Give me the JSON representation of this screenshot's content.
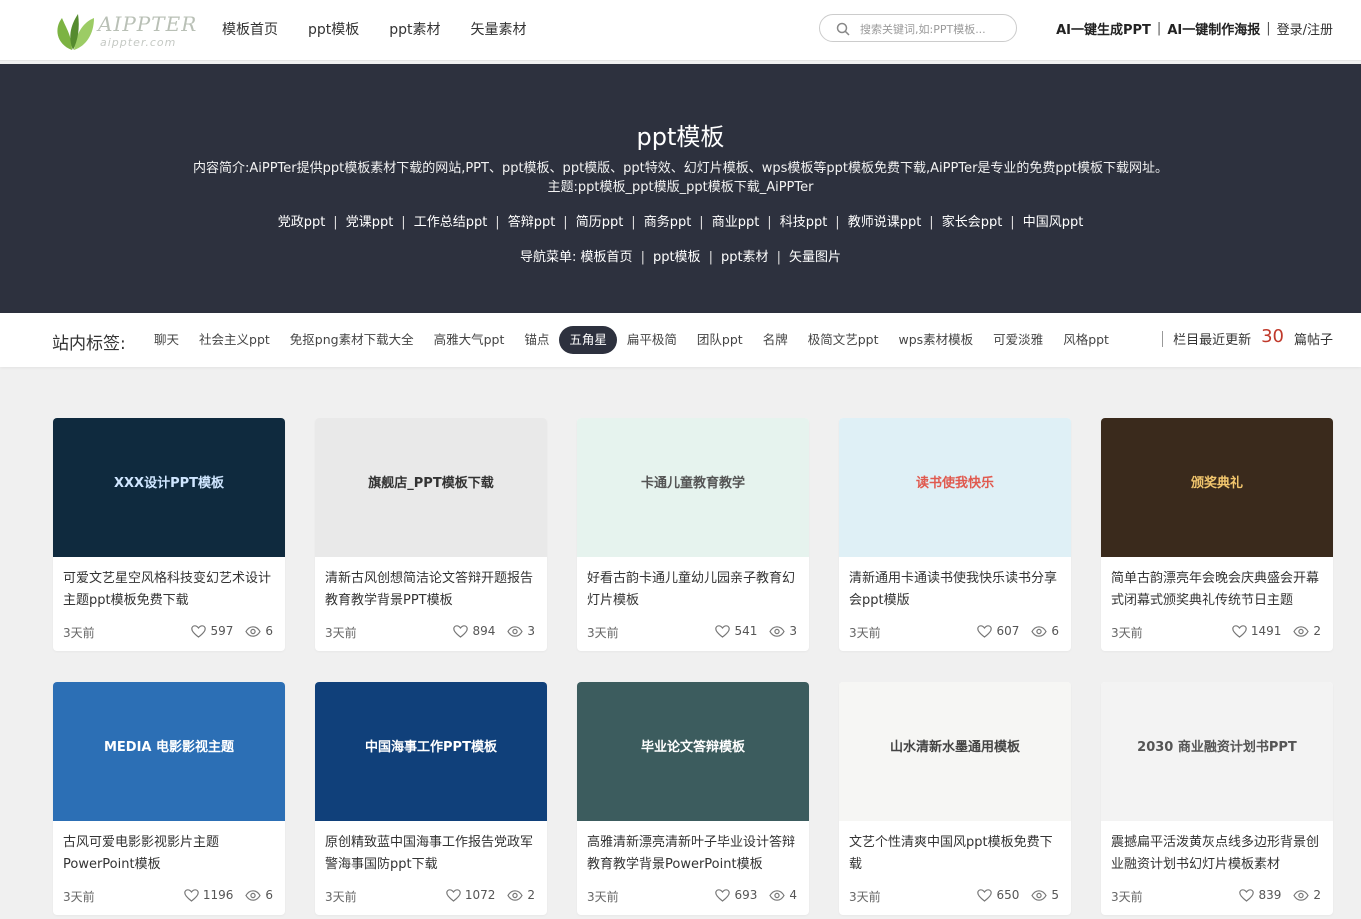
{
  "header": {
    "logo_name": "AIPPTER",
    "logo_sub": "aippter.com",
    "nav": [
      "模板首页",
      "ppt模板",
      "ppt素材",
      "矢量素材"
    ],
    "search_placeholder": "搜索关键词,如:PPT模板...",
    "ai_ppt": "AI一键生成PPT",
    "ai_poster": "AI一键制作海报",
    "login": "登录/注册",
    "sep": "|"
  },
  "hero": {
    "title": "ppt模板",
    "description": "内容简介:AiPPTer提供ppt模板素材下载的网站,PPT、ppt模板、ppt模版、ppt特效、幻灯片模板、wps模板等ppt模板免费下载,AiPPTer是专业的免费ppt模板下载网址。",
    "theme": "主题:ppt模板_ppt模版_ppt模板下载_AiPPTer",
    "tags": [
      "党政ppt",
      "党课ppt",
      "工作总结ppt",
      "答辩ppt",
      "简历ppt",
      "商务ppt",
      "商业ppt",
      "科技ppt",
      "教师说课ppt",
      "家长会ppt",
      "中国风ppt"
    ],
    "menu_label": "导航菜单:",
    "menu": [
      "模板首页",
      "ppt模板",
      "ppt素材",
      "矢量图片"
    ]
  },
  "tagbar": {
    "label": "站内标签:",
    "tags": [
      "聊天",
      "社会主义ppt",
      "免抠png素材下载大全",
      "高雅大气ppt",
      "锚点",
      "五角星",
      "扁平极简",
      "团队ppt",
      "名牌",
      "极简文艺ppt",
      "wps素材模板",
      "可爱淡雅",
      "风格ppt"
    ],
    "active_index": 5,
    "recent_prefix": "栏目最近更新",
    "recent_count": "30",
    "recent_suffix": "篇帖子"
  },
  "cards": [
    {
      "title": "可爱文艺星空风格科技变幻艺术设计主题ppt模板免费下载",
      "time": "3天前",
      "likes": "597",
      "views": "6",
      "thumb_text": "XXX设计PPT模板",
      "thumb_bg": "#0f2a3e",
      "thumb_fg": "#cfe6ff"
    },
    {
      "title": "清新古风创想简洁论文答辩开题报告教育教学背景PPT模板",
      "time": "3天前",
      "likes": "894",
      "views": "3",
      "thumb_text": "旗舰店_PPT模板下载",
      "thumb_bg": "#e9e9e9",
      "thumb_fg": "#333333"
    },
    {
      "title": "好看古韵卡通儿童幼儿园亲子教育幻灯片模板",
      "time": "3天前",
      "likes": "541",
      "views": "3",
      "thumb_text": "卡通儿童教育教学",
      "thumb_bg": "#e6f3ee",
      "thumb_fg": "#555555"
    },
    {
      "title": "清新通用卡通读书使我快乐读书分享会ppt模版",
      "time": "3天前",
      "likes": "607",
      "views": "6",
      "thumb_text": "读书使我快乐",
      "thumb_bg": "#dff0f6",
      "thumb_fg": "#e05a4f"
    },
    {
      "title": "简单古韵漂亮年会晚会庆典盛会开幕式闭幕式颁奖典礼传统节日主题",
      "time": "3天前",
      "likes": "1491",
      "views": "2",
      "thumb_text": "颁奖典礼",
      "thumb_bg": "#3a2a1c",
      "thumb_fg": "#f2c66d"
    },
    {
      "title": "古风可爱电影影视影片主题PowerPoint模板",
      "time": "3天前",
      "likes": "1196",
      "views": "6",
      "thumb_text": "MEDIA 电影影视主题",
      "thumb_bg": "#2c6fb5",
      "thumb_fg": "#ffffff"
    },
    {
      "title": "原创精致蓝中国海事工作报告党政军警海事国防ppt下载",
      "time": "3天前",
      "likes": "1072",
      "views": "2",
      "thumb_text": "中国海事工作PPT模板",
      "thumb_bg": "#10407a",
      "thumb_fg": "#ffffff"
    },
    {
      "title": "高雅清新漂亮清新叶子毕业设计答辩教育教学背景PowerPoint模板",
      "time": "3天前",
      "likes": "693",
      "views": "4",
      "thumb_text": "毕业论文答辩模板",
      "thumb_bg": "#3c5c5e",
      "thumb_fg": "#ffffff"
    },
    {
      "title": "文艺个性清爽中国风ppt模板免费下载",
      "time": "3天前",
      "likes": "650",
      "views": "5",
      "thumb_text": "山水清新水墨通用模板",
      "thumb_bg": "#f6f6f4",
      "thumb_fg": "#444444"
    },
    {
      "title": "震撼扁平活泼黄灰点线多边形背景创业融资计划书幻灯片模板素材",
      "time": "3天前",
      "likes": "839",
      "views": "2",
      "thumb_text": "2030 商业融资计划书PPT",
      "thumb_bg": "#f3f3f3",
      "thumb_fg": "#555555"
    }
  ]
}
